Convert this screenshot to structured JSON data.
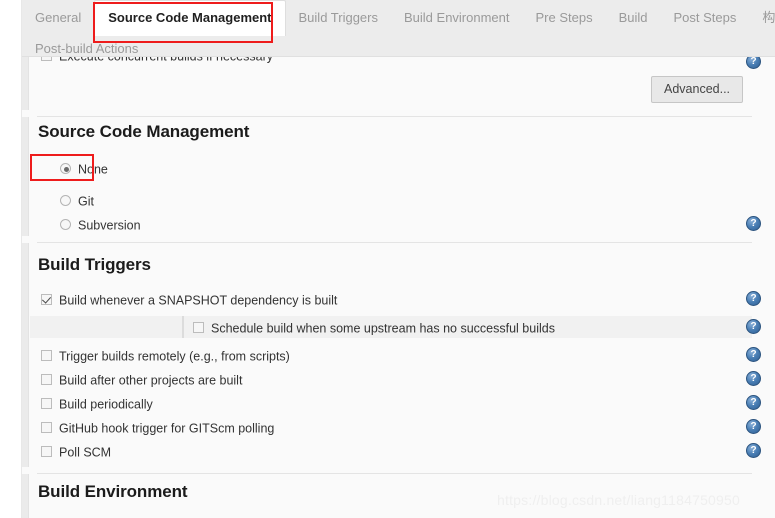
{
  "tabs": {
    "row1": [
      {
        "label": "General",
        "active": false
      },
      {
        "label": "Source Code Management",
        "active": true
      },
      {
        "label": "Build Triggers",
        "active": false
      },
      {
        "label": "Build Environment",
        "active": false
      },
      {
        "label": "Pre Steps",
        "active": false
      },
      {
        "label": "Build",
        "active": false
      },
      {
        "label": "Post Steps",
        "active": false
      },
      {
        "label": "构建设置",
        "active": false
      }
    ],
    "row2": [
      {
        "label": "Post-build Actions",
        "active": false
      }
    ]
  },
  "general_tail": {
    "clipped_option_label": "Execute concurrent builds if necessary",
    "advanced_button_label": "Advanced..."
  },
  "scm": {
    "section_title": "Source Code Management",
    "options": [
      {
        "label": "None",
        "selected": true
      },
      {
        "label": "Git",
        "selected": false
      },
      {
        "label": "Subversion",
        "selected": false
      }
    ]
  },
  "build_triggers": {
    "section_title": "Build Triggers",
    "options": [
      {
        "label": "Build whenever a SNAPSHOT dependency is built",
        "checked": true
      },
      {
        "label": "Trigger builds remotely (e.g., from scripts)",
        "checked": false
      },
      {
        "label": "Build after other projects are built",
        "checked": false
      },
      {
        "label": "Build periodically",
        "checked": false
      },
      {
        "label": "GitHub hook trigger for GITScm polling",
        "checked": false
      },
      {
        "label": "Poll SCM",
        "checked": false
      }
    ],
    "nested_option": {
      "label": "Schedule build when some upstream has no successful builds",
      "checked": false
    }
  },
  "build_environment": {
    "section_title": "Build Environment"
  },
  "help_icon": {
    "glyph": "?",
    "name": "help-icon"
  },
  "annotations": [
    {
      "name": "annotation-box-source-code-management-tab",
      "color": "#ee1c1c"
    },
    {
      "name": "annotation-box-scm-none-option",
      "color": "#ee1c1c"
    }
  ],
  "watermark": {
    "text": "https://blog.csdn.net/liang1184750950"
  }
}
